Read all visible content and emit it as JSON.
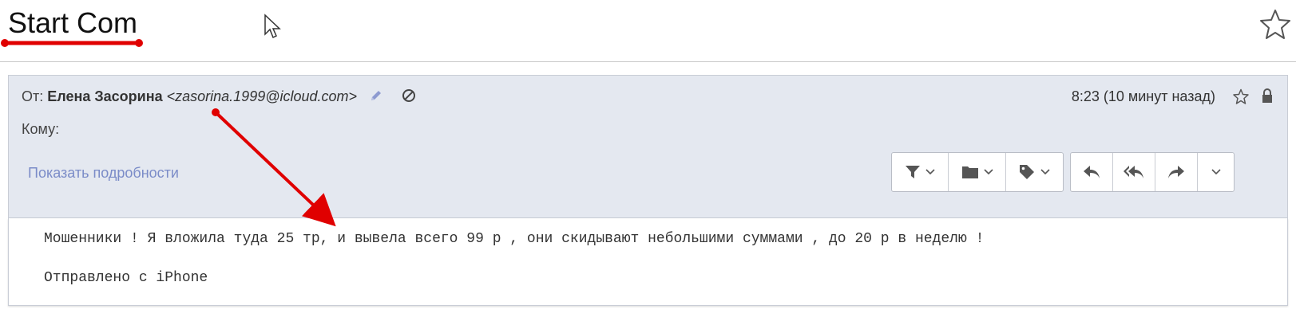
{
  "subject": "Start Com",
  "email": {
    "from_label": "От:",
    "sender_name": "Елена Засорина",
    "sender_email": "<zasorina.1999@icloud.com>",
    "datetime": "8:23 (10 минут назад)",
    "to_label": "Кому:",
    "show_details": "Показать подробности"
  },
  "body": {
    "line1": "Мошенники ! Я вложила туда 25 тр, и вывела всего 99 р , они скидывают небольшими суммами , до 20 р в неделю !",
    "line2": "Отправлено с iPhone"
  },
  "toolbar": {
    "group1": [
      "filter-icon",
      "folder-icon",
      "tag-icon"
    ],
    "group2": [
      "reply-icon",
      "reply-all-icon",
      "forward-icon",
      "more-chevron-icon"
    ]
  },
  "colors": {
    "header_bg": "#e4e8f0",
    "link": "#7b8cc8",
    "annotation_red": "#e00000"
  }
}
